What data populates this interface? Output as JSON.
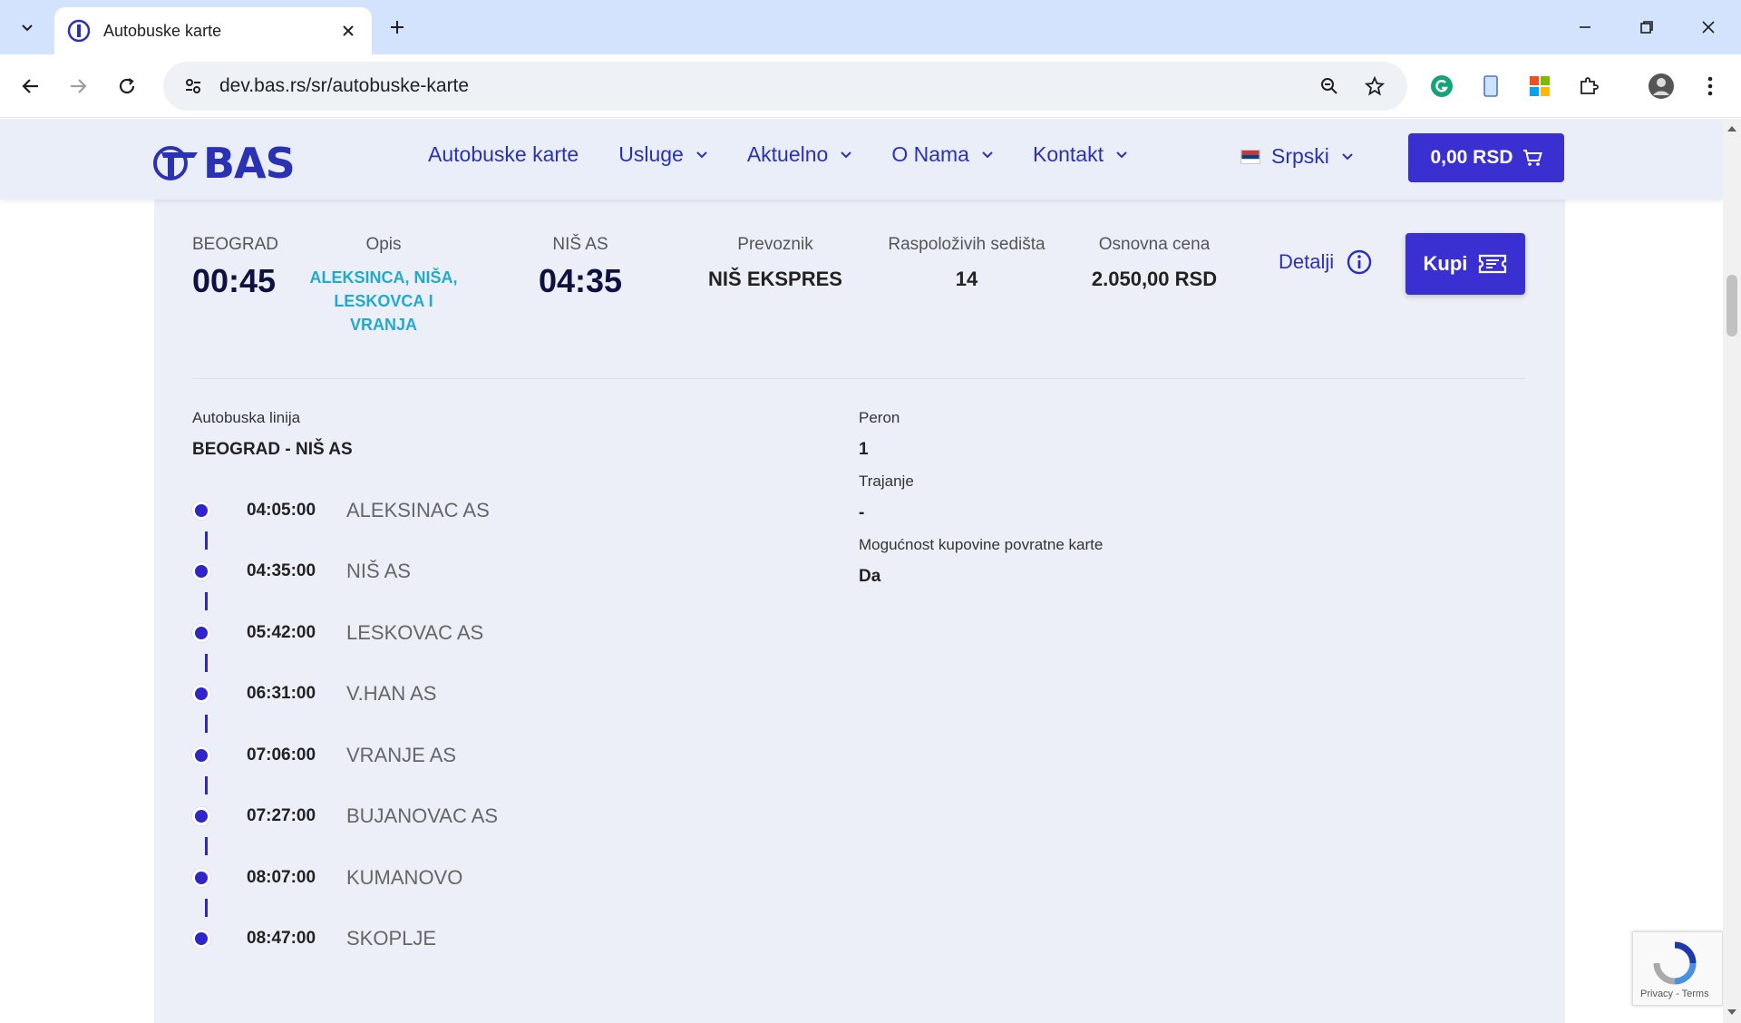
{
  "browser": {
    "tab_title": "Autobuske karte",
    "url": "dev.bas.rs/sr/autobuske-karte"
  },
  "site": {
    "logo_text": "BAS",
    "menu": [
      {
        "label": "Autobuske karte",
        "has_dropdown": false
      },
      {
        "label": "Usluge",
        "has_dropdown": true
      },
      {
        "label": "Aktuelno",
        "has_dropdown": true
      },
      {
        "label": "O Nama",
        "has_dropdown": true
      },
      {
        "label": "Kontakt",
        "has_dropdown": true
      }
    ],
    "language": "Srpski",
    "cart_label": "0,00 RSD",
    "accent_color": "#3a2fd1"
  },
  "trip": {
    "departure": {
      "label": "BEOGRAD",
      "time": "00:45"
    },
    "opis": {
      "label": "Opis",
      "lines": [
        "ALEKSINCA, NIŠA,",
        "LESKOVCA I",
        "VRANJA"
      ]
    },
    "arrival": {
      "label": "NIŠ AS",
      "time": "04:35"
    },
    "carrier": {
      "label": "Prevoznik",
      "value": "NIŠ EKSPRES"
    },
    "seats": {
      "label": "Raspoloživih sedišta",
      "value": "14"
    },
    "price": {
      "label": "Osnovna cena",
      "value": "2.050,00 RSD"
    },
    "details_label": "Detalji",
    "buy_label": "Kupi"
  },
  "line_info": {
    "line_label": "Autobuska linija",
    "line_value": "BEOGRAD - NIŠ AS",
    "platform_label": "Peron",
    "platform_value": "1",
    "duration_label": "Trajanje",
    "duration_value": "-",
    "return_label": "Mogućnost kupovine povratne karte",
    "return_value": "Da"
  },
  "stops": [
    {
      "time": "04:05:00",
      "name": "ALEKSINAC AS"
    },
    {
      "time": "04:35:00",
      "name": "NIŠ AS"
    },
    {
      "time": "05:42:00",
      "name": "LESKOVAC AS"
    },
    {
      "time": "06:31:00",
      "name": "V.HAN AS"
    },
    {
      "time": "07:06:00",
      "name": "VRANJE AS"
    },
    {
      "time": "07:27:00",
      "name": "BUJANOVAC AS"
    },
    {
      "time": "08:07:00",
      "name": "KUMANOVO"
    },
    {
      "time": "08:47:00",
      "name": "SKOPLJE"
    }
  ],
  "recaptcha": {
    "links": "Privacy - Terms"
  }
}
